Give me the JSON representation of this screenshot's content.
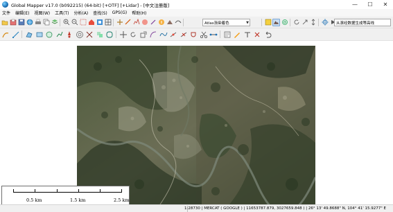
{
  "window": {
    "title": "Global Mapper v17.0 (b092215) (64-bit) [+OTF] [+Lidar] - [中文注册版]",
    "minimize": "—",
    "maximize": "☐",
    "close": "✕"
  },
  "menu": [
    "文件",
    "编辑(E)",
    "视图(W)",
    "工具(T)",
    "分析(A)",
    "查找(S)",
    "GPS(G)",
    "帮助(H)"
  ],
  "toolbar": {
    "shader_select": "Atlas渐染着色",
    "search_select": "从滚经数据生成等高线"
  },
  "scale": {
    "labels": [
      "0.5 km",
      "1.5 km",
      "2.5 km"
    ]
  },
  "status": {
    "text": "1:28730 | MERCAT ( GOOGLE ) | 11653787.879, 3027659.848 ) | 26° 13' 49.8688\" N, 104° 41' 15.9277\" E"
  },
  "colors": {
    "accent": "#1a6fb5",
    "imagery_dark": "#3c4a2f",
    "imagery_light": "#8c8d78"
  }
}
